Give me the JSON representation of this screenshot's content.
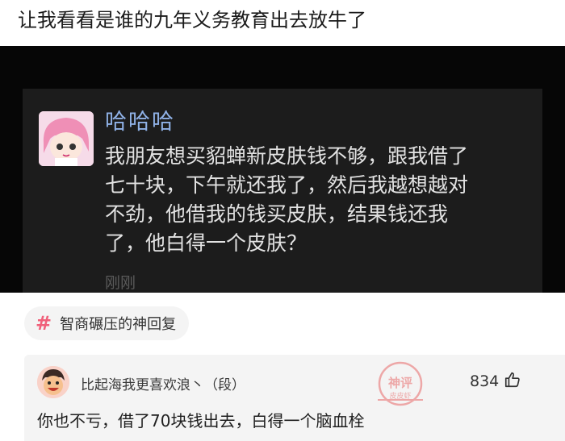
{
  "post": {
    "headline": "让我看看是谁的九年义务教育出去放牛了"
  },
  "screenshot": {
    "name": "哈哈哈",
    "lines": [
      "我朋友想买貂蝉新皮肤钱不够，跟我借了",
      "七十块，下午就还我了，然后我越想越对",
      "不劲，他借我的钱买皮肤，结果钱还我",
      "了，他白得一个皮肤？"
    ],
    "time": "刚刚"
  },
  "topic": {
    "icon": "hash-icon",
    "label": "智商碾压的神回复"
  },
  "comment": {
    "username": "比起海我更喜欢浪丶（段）",
    "stamp_text": "神评",
    "stamp_sub": "皮皮虾",
    "like_count": "834",
    "like_icon": "thumbs-up-icon",
    "text": "你也不亏，借了70块钱出去，白得一个脑血栓"
  },
  "colors": {
    "name_blue": "#8fb1e6",
    "hash_pink": "#f0607a",
    "stamp_red": "#e86a6a"
  }
}
